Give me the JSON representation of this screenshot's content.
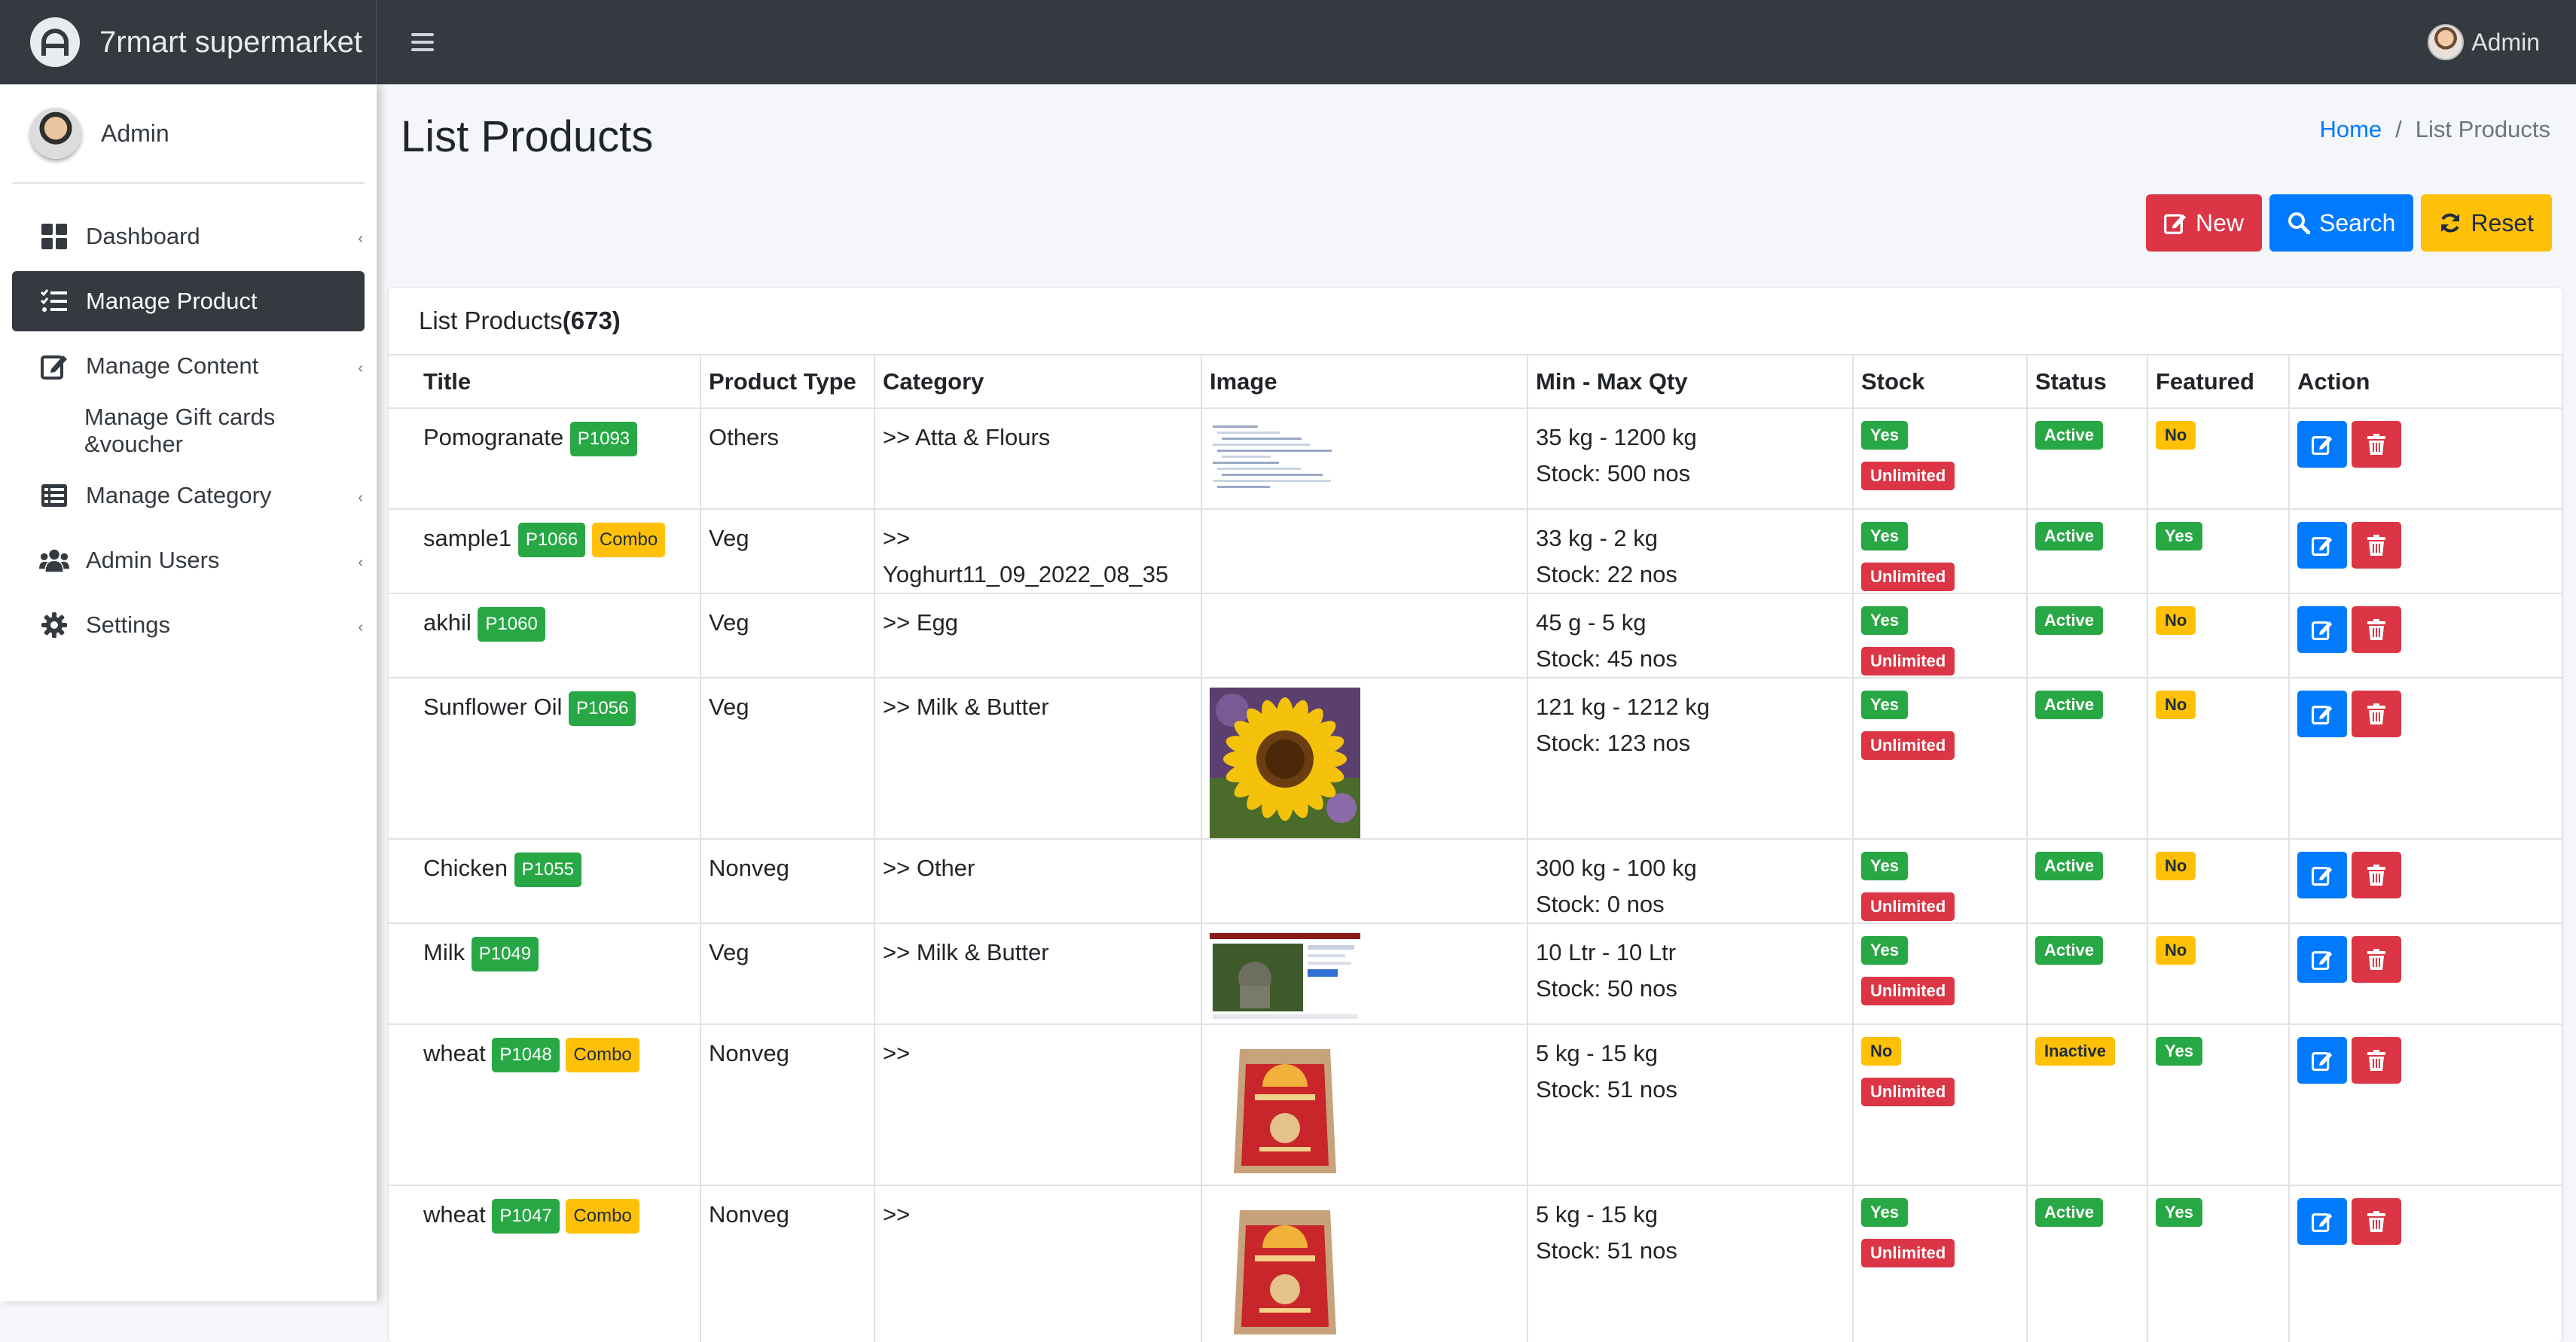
{
  "app": {
    "brand": "7rmart supermarket",
    "user": "Admin"
  },
  "sidebar": {
    "user": "Admin",
    "items": [
      {
        "label": "Dashboard",
        "icon": "dashboard-icon"
      },
      {
        "label": "Manage Product",
        "icon": "list-check-icon",
        "active": true
      },
      {
        "label": "Manage Content",
        "icon": "edit-icon"
      },
      {
        "label": "Manage Gift cards &voucher",
        "icon": ""
      },
      {
        "label": "Manage Category",
        "icon": "list-icon"
      },
      {
        "label": "Admin Users",
        "icon": "users-icon"
      },
      {
        "label": "Settings",
        "icon": "gear-icon"
      }
    ]
  },
  "page": {
    "title": "List Products",
    "breadcrumb": {
      "home": "Home",
      "sep": "/",
      "current": "List Products"
    },
    "buttons": {
      "new": "New",
      "search": "Search",
      "reset": "Reset"
    },
    "card": {
      "title": "List Products",
      "count": "(673)"
    }
  },
  "table": {
    "headers": [
      "Title",
      "Product Type",
      "Category",
      "Image",
      "Min - Max Qty",
      "Stock",
      "Status",
      "Featured",
      "Action"
    ],
    "rows": [
      {
        "title": "Pomogranate",
        "code": "P1093",
        "combo": "",
        "type": "Others",
        "category": ">> Atta & Flours",
        "image": "screenshot",
        "qty": "35 kg - 1200 kg",
        "stock_count": "Stock: 500 nos",
        "stock": "Yes",
        "unlimited": "Unlimited",
        "status": "Active",
        "featured": "No"
      },
      {
        "title": "sample1",
        "code": "P1066",
        "combo": "Combo",
        "type": "Veg",
        "category": ">> Yoghurt11_09_2022_08_35",
        "image": "",
        "qty": "33 kg - 2 kg",
        "stock_count": "Stock: 22 nos",
        "stock": "Yes",
        "unlimited": "Unlimited",
        "status": "Active",
        "featured": "Yes"
      },
      {
        "title": "akhil",
        "code": "P1060",
        "combo": "",
        "type": "Veg",
        "category": ">> Egg",
        "image": "",
        "qty": "45 g - 5 kg",
        "stock_count": "Stock: 45 nos",
        "stock": "Yes",
        "unlimited": "Unlimited",
        "status": "Active",
        "featured": "No"
      },
      {
        "title": "Sunflower Oil",
        "code": "P1056",
        "combo": "",
        "type": "Veg",
        "category": ">> Milk & Butter",
        "image": "sunflower",
        "qty": "121 kg - 1212 kg",
        "stock_count": "Stock: 123 nos",
        "stock": "Yes",
        "unlimited": "Unlimited",
        "status": "Active",
        "featured": "No"
      },
      {
        "title": "Chicken",
        "code": "P1055",
        "combo": "",
        "type": "Nonveg",
        "category": ">> Other",
        "image": "",
        "qty": "300 kg - 100 kg",
        "stock_count": "Stock: 0 nos",
        "stock": "Yes",
        "unlimited": "Unlimited",
        "status": "Active",
        "featured": "No"
      },
      {
        "title": "Milk",
        "code": "P1049",
        "combo": "",
        "type": "Veg",
        "category": ">> Milk & Butter",
        "image": "webpage",
        "qty": "10 Ltr - 10 Ltr",
        "stock_count": "Stock: 50 nos",
        "stock": "Yes",
        "unlimited": "Unlimited",
        "status": "Active",
        "featured": "No"
      },
      {
        "title": "wheat",
        "code": "P1048",
        "combo": "Combo",
        "type": "Nonveg",
        "category": ">>",
        "image": "flour-bag",
        "qty": "5 kg - 15 kg",
        "stock_count": "Stock: 51 nos",
        "stock": "No",
        "unlimited": "Unlimited",
        "status": "Inactive",
        "featured": "Yes"
      },
      {
        "title": "wheat",
        "code": "P1047",
        "combo": "Combo",
        "type": "Nonveg",
        "category": ">>",
        "image": "flour-bag",
        "qty": "5 kg - 15 kg",
        "stock_count": "Stock: 51 nos",
        "stock": "Yes",
        "unlimited": "Unlimited",
        "status": "Active",
        "featured": "Yes"
      }
    ]
  },
  "colors": {
    "primary": "#007bff",
    "danger": "#dc3545",
    "warning": "#ffc107",
    "success": "#28a745",
    "dark": "#343a40"
  }
}
